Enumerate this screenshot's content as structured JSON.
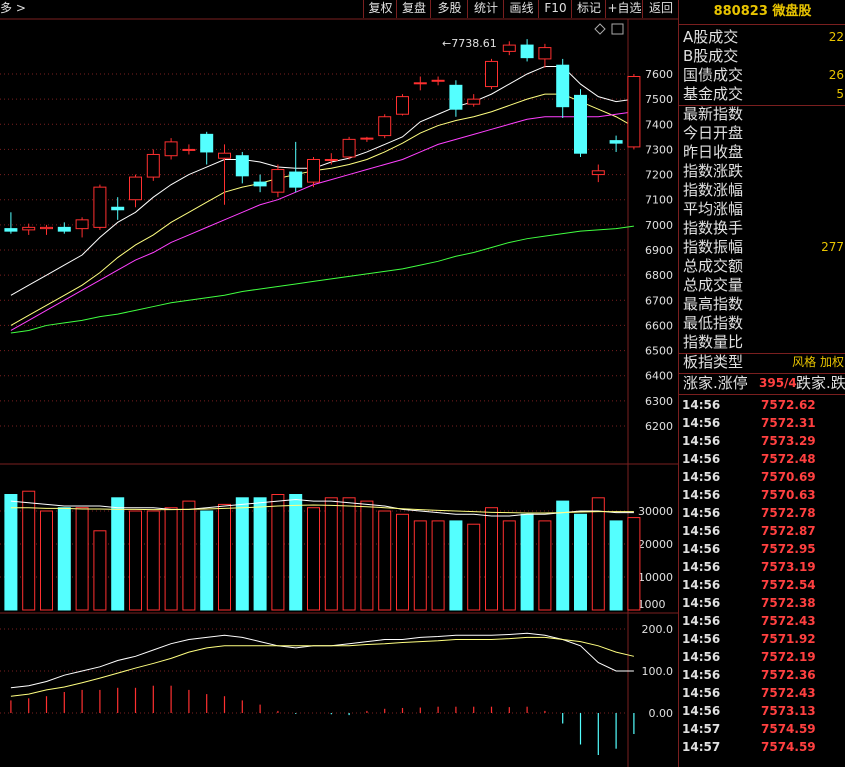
{
  "toolbar": {
    "menu_left": "多 >",
    "buttons": [
      "复权",
      "复盘",
      "多股",
      "统计",
      "画线",
      "F10",
      "标记",
      "+自选",
      "返回"
    ]
  },
  "chart_data": {
    "type": "candlestick",
    "title": "",
    "high_label": "7738.61",
    "price_axis": {
      "ticks": [
        6200,
        6300,
        6400,
        6500,
        6600,
        6700,
        6800,
        6900,
        7000,
        7100,
        7200,
        7300,
        7400,
        7500,
        7600
      ],
      "min": 6200,
      "max": 7600
    },
    "candles": [
      {
        "o": 6985,
        "c": 6975,
        "h": 7050,
        "l": 6965
      },
      {
        "o": 6980,
        "c": 6990,
        "h": 7005,
        "l": 6960
      },
      {
        "o": 6985,
        "c": 6990,
        "h": 7000,
        "l": 6960
      },
      {
        "o": 6990,
        "c": 6975,
        "h": 7010,
        "l": 6965
      },
      {
        "o": 6985,
        "c": 7020,
        "h": 7030,
        "l": 6950
      },
      {
        "o": 6990,
        "c": 7150,
        "h": 7160,
        "l": 6980
      },
      {
        "o": 7070,
        "c": 7060,
        "h": 7110,
        "l": 7020
      },
      {
        "o": 7100,
        "c": 7190,
        "h": 7200,
        "l": 7070
      },
      {
        "o": 7190,
        "c": 7280,
        "h": 7300,
        "l": 7175
      },
      {
        "o": 7275,
        "c": 7330,
        "h": 7345,
        "l": 7260
      },
      {
        "o": 7300,
        "c": 7300,
        "h": 7320,
        "l": 7280
      },
      {
        "o": 7360,
        "c": 7290,
        "h": 7370,
        "l": 7240
      },
      {
        "o": 7265,
        "c": 7285,
        "h": 7320,
        "l": 7080
      },
      {
        "o": 7275,
        "c": 7195,
        "h": 7290,
        "l": 7165
      },
      {
        "o": 7170,
        "c": 7155,
        "h": 7200,
        "l": 7130
      },
      {
        "o": 7130,
        "c": 7220,
        "h": 7240,
        "l": 7110
      },
      {
        "o": 7210,
        "c": 7150,
        "h": 7330,
        "l": 7130
      },
      {
        "o": 7170,
        "c": 7260,
        "h": 7270,
        "l": 7150
      },
      {
        "o": 7260,
        "c": 7260,
        "h": 7285,
        "l": 7240
      },
      {
        "o": 7270,
        "c": 7340,
        "h": 7350,
        "l": 7260
      },
      {
        "o": 7345,
        "c": 7345,
        "h": 7350,
        "l": 7330
      },
      {
        "o": 7355,
        "c": 7430,
        "h": 7440,
        "l": 7345
      },
      {
        "o": 7440,
        "c": 7510,
        "h": 7520,
        "l": 7435
      },
      {
        "o": 7565,
        "c": 7565,
        "h": 7590,
        "l": 7535
      },
      {
        "o": 7575,
        "c": 7575,
        "h": 7590,
        "l": 7555
      },
      {
        "o": 7555,
        "c": 7460,
        "h": 7575,
        "l": 7430
      },
      {
        "o": 7480,
        "c": 7500,
        "h": 7520,
        "l": 7470
      },
      {
        "o": 7550,
        "c": 7650,
        "h": 7660,
        "l": 7540
      },
      {
        "o": 7690,
        "c": 7715,
        "h": 7730,
        "l": 7675
      },
      {
        "o": 7715,
        "c": 7665,
        "h": 7738.61,
        "l": 7650
      },
      {
        "o": 7660,
        "c": 7705,
        "h": 7720,
        "l": 7625
      },
      {
        "o": 7635,
        "c": 7470,
        "h": 7660,
        "l": 7425
      },
      {
        "o": 7515,
        "c": 7285,
        "h": 7540,
        "l": 7270
      },
      {
        "o": 7200,
        "c": 7215,
        "h": 7240,
        "l": 7170
      },
      {
        "o": 7335,
        "c": 7325,
        "h": 7355,
        "l": 7290
      },
      {
        "o": 7310,
        "c": 7590,
        "h": 7600,
        "l": 7300
      }
    ],
    "ma": [
      {
        "color": "#ffffff",
        "values": [
          6720,
          6760,
          6800,
          6840,
          6880,
          6950,
          7010,
          7050,
          7110,
          7160,
          7200,
          7230,
          7260,
          7260,
          7250,
          7230,
          7225,
          7225,
          7250,
          7265,
          7290,
          7320,
          7350,
          7410,
          7440,
          7470,
          7490,
          7520,
          7560,
          7600,
          7630,
          7630,
          7560,
          7510,
          7490,
          7500
        ]
      },
      {
        "color": "#ffff80",
        "values": [
          6600,
          6640,
          6680,
          6720,
          6760,
          6810,
          6870,
          6920,
          6960,
          7010,
          7050,
          7090,
          7130,
          7150,
          7165,
          7185,
          7200,
          7215,
          7225,
          7240,
          7260,
          7290,
          7325,
          7365,
          7395,
          7415,
          7430,
          7450,
          7475,
          7500,
          7520,
          7520,
          7490,
          7460,
          7430,
          7390
        ]
      },
      {
        "color": "#ff40ff",
        "values": [
          6580,
          6620,
          6660,
          6700,
          6740,
          6780,
          6820,
          6860,
          6890,
          6930,
          6960,
          6990,
          7020,
          7050,
          7080,
          7100,
          7130,
          7160,
          7180,
          7200,
          7220,
          7240,
          7260,
          7290,
          7320,
          7340,
          7360,
          7380,
          7400,
          7420,
          7430,
          7430,
          7430,
          7430,
          7440,
          7450
        ]
      },
      {
        "color": "#40ff40",
        "values": [
          6570,
          6580,
          6600,
          6610,
          6620,
          6635,
          6645,
          6660,
          6675,
          6690,
          6700,
          6710,
          6720,
          6735,
          6745,
          6755,
          6765,
          6775,
          6785,
          6795,
          6805,
          6815,
          6825,
          6840,
          6855,
          6875,
          6890,
          6910,
          6930,
          6945,
          6955,
          6965,
          6975,
          6980,
          6985,
          6995
        ]
      }
    ],
    "volume": {
      "unit_label": "X1000",
      "ticks": [
        10000,
        20000,
        30000
      ],
      "max": 40000,
      "values": [
        35000,
        36000,
        30000,
        31000,
        31000,
        24000,
        34000,
        30000,
        30000,
        31000,
        33000,
        30000,
        32000,
        34000,
        34000,
        35000,
        35000,
        31000,
        34000,
        34000,
        33000,
        30000,
        29000,
        27000,
        27000,
        27000,
        26000,
        31000,
        27000,
        29000,
        27000,
        33000,
        29000,
        34000,
        27000,
        28000
      ],
      "ma": [
        {
          "color": "#ffffff",
          "values": [
            33000,
            32500,
            32000,
            31500,
            31500,
            31500,
            31000,
            31000,
            31000,
            30500,
            30500,
            31000,
            31500,
            32000,
            32500,
            33000,
            33500,
            33000,
            33000,
            32500,
            32000,
            31500,
            30500,
            30000,
            29500,
            29000,
            29000,
            28500,
            28500,
            29000,
            29000,
            29500,
            30000,
            30000,
            29500,
            29500
          ]
        },
        {
          "color": "#ffff80",
          "values": [
            31000,
            31000,
            30800,
            30800,
            30600,
            30600,
            30500,
            30500,
            30400,
            30400,
            30500,
            30600,
            30800,
            31000,
            31200,
            31500,
            31700,
            31800,
            31700,
            31500,
            31300,
            31000,
            30700,
            30400,
            30200,
            30000,
            29800,
            29600,
            29500,
            29400,
            29400,
            29500,
            29700,
            29800,
            29800,
            29800
          ]
        }
      ]
    },
    "macd": {
      "ticks": [
        0,
        100,
        200
      ],
      "labels": [
        "0.00",
        "100.0",
        "200.0"
      ],
      "min": -100,
      "max": 200,
      "dif": [
        60,
        65,
        75,
        90,
        100,
        110,
        125,
        135,
        150,
        165,
        175,
        180,
        185,
        180,
        170,
        160,
        155,
        160,
        160,
        165,
        170,
        175,
        175,
        180,
        182,
        185,
        185,
        185,
        187,
        190,
        185,
        175,
        160,
        120,
        100,
        100
      ],
      "dea": [
        40,
        45,
        55,
        62,
        72,
        83,
        95,
        107,
        118,
        130,
        145,
        155,
        160,
        160,
        160,
        160,
        160,
        160,
        160,
        160,
        163,
        165,
        168,
        170,
        172,
        175,
        175,
        175,
        177,
        180,
        180,
        175,
        170,
        160,
        145,
        135
      ],
      "hist": [
        30,
        35,
        40,
        50,
        55,
        55,
        60,
        60,
        65,
        65,
        55,
        45,
        40,
        30,
        20,
        5,
        -2,
        0,
        -3,
        -5,
        5,
        10,
        12,
        13,
        15,
        15,
        15,
        15,
        14,
        15,
        5,
        -25,
        -75,
        -100,
        -85,
        -50
      ]
    }
  },
  "info": {
    "title": "880823 微盘股",
    "rows": [
      {
        "label": "A股成交",
        "value": "22"
      },
      {
        "label": "B股成交",
        "value": ""
      },
      {
        "label": "国债成交",
        "value": "26"
      },
      {
        "label": "基金成交",
        "value": "5"
      },
      {
        "label": "最新指数",
        "value": ""
      },
      {
        "label": "今日开盘",
        "value": ""
      },
      {
        "label": "昨日收盘",
        "value": ""
      },
      {
        "label": "指数涨跌",
        "value": ""
      },
      {
        "label": "指数涨幅",
        "value": ""
      },
      {
        "label": "平均涨幅",
        "value": ""
      },
      {
        "label": "指数换手",
        "value": ""
      },
      {
        "label": "指数振幅",
        "value": "277"
      },
      {
        "label": "总成交额",
        "value": ""
      },
      {
        "label": "总成交量",
        "value": ""
      },
      {
        "label": "最高指数",
        "value": ""
      },
      {
        "label": "最低指数",
        "value": ""
      },
      {
        "label": "指数量比",
        "value": ""
      }
    ],
    "board_type_label": "板指类型",
    "board_type_value": "风格 加权",
    "rise_fall_label": "涨家.涨停",
    "rise_fall_value": "395/4",
    "fall_label": "跌家.跌",
    "ticks": [
      {
        "time": "14:56",
        "price": "7572.62"
      },
      {
        "time": "14:56",
        "price": "7572.31"
      },
      {
        "time": "14:56",
        "price": "7573.29"
      },
      {
        "time": "14:56",
        "price": "7572.48"
      },
      {
        "time": "14:56",
        "price": "7570.69"
      },
      {
        "time": "14:56",
        "price": "7570.63"
      },
      {
        "time": "14:56",
        "price": "7572.78"
      },
      {
        "time": "14:56",
        "price": "7572.87"
      },
      {
        "time": "14:56",
        "price": "7572.95"
      },
      {
        "time": "14:56",
        "price": "7573.19"
      },
      {
        "time": "14:56",
        "price": "7572.54"
      },
      {
        "time": "14:56",
        "price": "7572.38"
      },
      {
        "time": "14:56",
        "price": "7572.43"
      },
      {
        "time": "14:56",
        "price": "7571.92"
      },
      {
        "time": "14:56",
        "price": "7572.19"
      },
      {
        "time": "14:56",
        "price": "7572.36"
      },
      {
        "time": "14:56",
        "price": "7572.43"
      },
      {
        "time": "14:56",
        "price": "7573.13"
      },
      {
        "time": "14:57",
        "price": "7574.59"
      },
      {
        "time": "14:57",
        "price": "7574.59"
      }
    ]
  },
  "colors": {
    "up": "#ff3030",
    "down": "#54ffff",
    "grid": "#7a1f1f",
    "axis_text": "#e0e0e0"
  }
}
